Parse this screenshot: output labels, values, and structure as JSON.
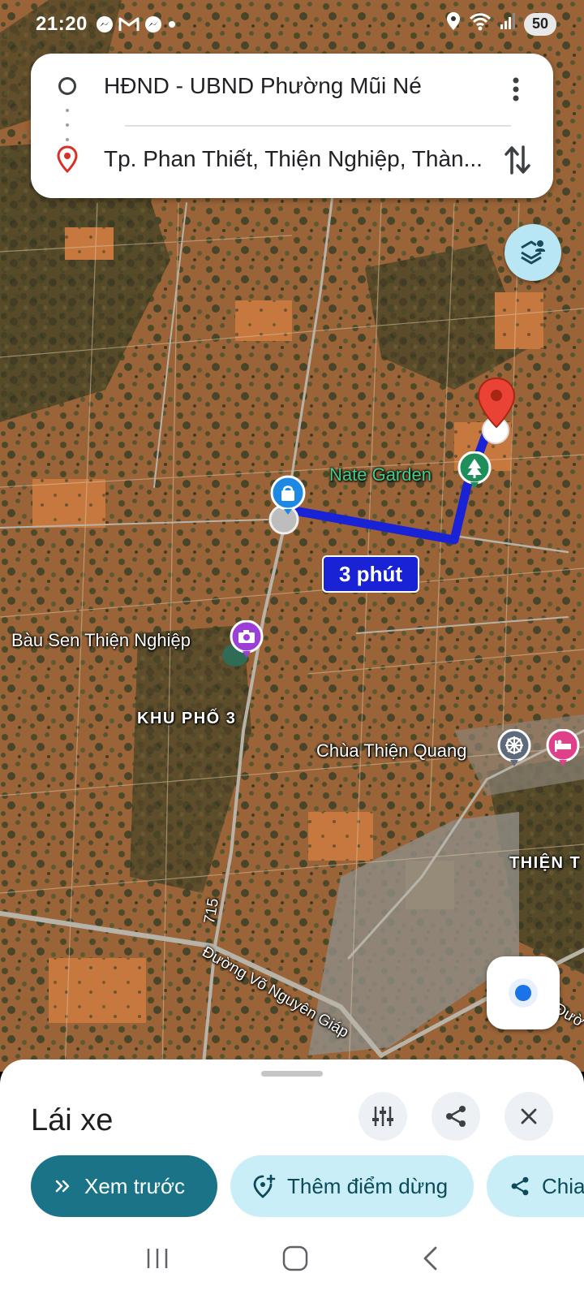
{
  "status_bar": {
    "time": "21:20",
    "notification_icons": [
      "messenger-icon",
      "gmail-icon",
      "messenger-icon",
      "dot-icon"
    ],
    "system_icons": [
      "location-icon",
      "wifi-icon",
      "signal-icon"
    ],
    "battery": "50"
  },
  "directions": {
    "origin": "HĐND - UBND Phường Mũi Né",
    "destination": "Tp. Phan Thiết, Thiện Nghiệp, Thàn...",
    "more_icon": "more-vert-icon",
    "swap_icon": "swap-icon"
  },
  "map": {
    "poi_nate_garden": "Nate Garden",
    "poi_bau_sen": "Bàu Sen Thiện Nghiệp",
    "area_khu_pho_3": "KHU PHỐ 3",
    "poi_chua": "Chùa Thiện Quang",
    "area_thien": "THIỆN T",
    "route_number": "715",
    "road_name": "Đường Võ Nguyên Giáp",
    "road_edge": "Đườ",
    "duration": "3 phút",
    "colors": {
      "route": "#1a22d6",
      "destination_pin": "#ea4335",
      "layers_button": "#b8e6f4",
      "primary_chip": "#1b7388"
    }
  },
  "sheet": {
    "mode_title": "Lái xe",
    "primary_button": "Xem trước",
    "add_stop_button": "Thêm điểm dừng",
    "share_button": "Chia",
    "icons": [
      "tune-icon",
      "share-icon",
      "close-icon"
    ]
  }
}
